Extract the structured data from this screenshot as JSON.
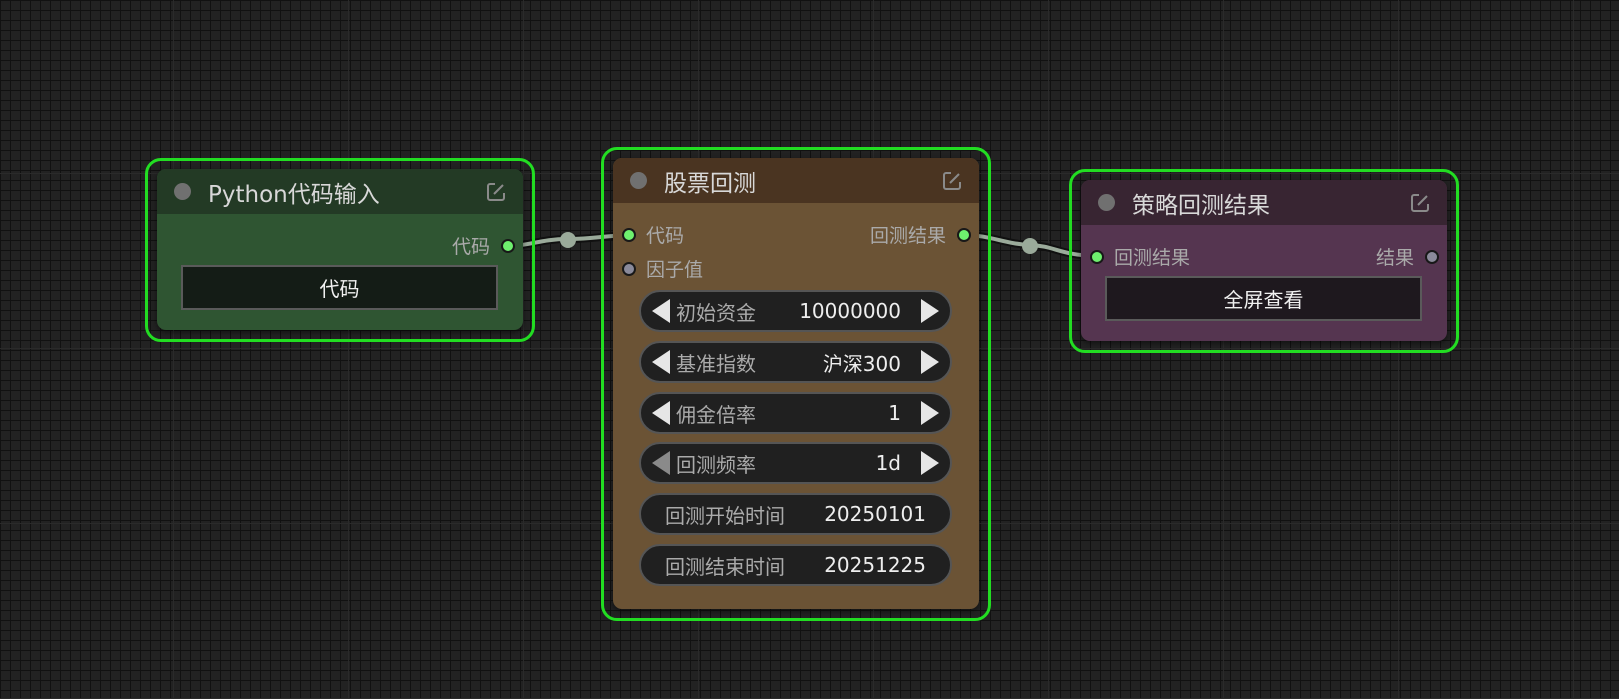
{
  "colors": {
    "selection_outline": "#22dd22",
    "link": "#9aaa9a",
    "connected_slot": "#6ef06e",
    "python_node_title": "#233a25",
    "python_node_body": "#2f5532",
    "backtest_node_title": "#4a3421",
    "backtest_node_body": "#6b5335",
    "result_node_title": "#382532",
    "result_node_body": "#553550"
  },
  "nodes": {
    "python_input": {
      "title": "Python代码输入",
      "outputs": [
        "代码"
      ],
      "button": "代码"
    },
    "stock_backtest": {
      "title": "股票回测",
      "inputs": [
        "代码",
        "因子值"
      ],
      "outputs": [
        "回测结果"
      ],
      "widgets": [
        {
          "label": "初始资金",
          "value": "10000000"
        },
        {
          "label": "基准指数",
          "value": "沪深300"
        },
        {
          "label": "佣金倍率",
          "value": "1"
        },
        {
          "label": "回测频率",
          "value": "1d"
        },
        {
          "label": "回测开始时间",
          "value": "20250101"
        },
        {
          "label": "回测结束时间",
          "value": "20251225"
        }
      ]
    },
    "strategy_result": {
      "title": "策略回测结果",
      "inputs": [
        "回测结果"
      ],
      "outputs": [
        "结果"
      ],
      "button": "全屏查看"
    }
  }
}
